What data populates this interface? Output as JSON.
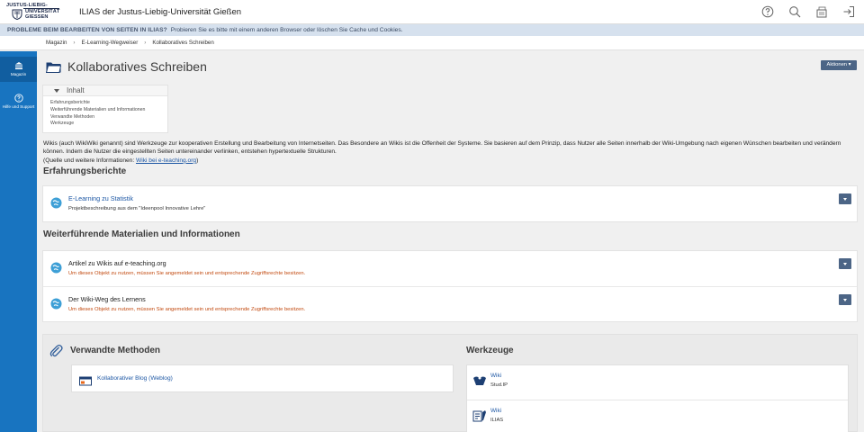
{
  "header": {
    "logo_text": [
      "JUSTUS-LIEBIG-",
      "UNIVERSITÄT",
      "GIESSEN"
    ],
    "site_title": "ILIAS der Justus-Liebig-Universität Gießen",
    "icons": [
      "help-icon",
      "search-icon",
      "notifications-icon",
      "logout-icon"
    ]
  },
  "banner": {
    "title": "PROBLEME BEIM BEARBEITEN VON SEITEN IN ILIAS?",
    "message": "Probieren Sie es bitte mit einem anderen Browser oder löschen Sie Cache und Cookies."
  },
  "breadcrumb": [
    "Magazin",
    "E-Learning-Wegweiser",
    "Kollaboratives Schreiben"
  ],
  "sidenav": [
    {
      "label": "Magazin",
      "icon": "repository-icon"
    },
    {
      "label": "Hilfe und Support",
      "icon": "help-support-icon"
    }
  ],
  "page": {
    "title": "Kollaboratives Schreiben",
    "actions_label": "Aktionen ▾"
  },
  "toc": {
    "heading": "Inhalt",
    "items": [
      "Erfahrungsberichte",
      "Weiterführende Materialien und Informationen",
      "Verwandte Methoden",
      "Werkzeuge"
    ]
  },
  "intro": {
    "text": "Wikis (auch WikiWiki genannt) sind Werkzeuge zur kooperativen Erstellung und Bearbeitung von Internetseiten. Das Besondere an Wikis ist die Offenheit der Systeme. Sie basieren auf dem Prinzip, dass Nutzer alle Seiten innerhalb der Wiki-Umgebung nach eigenen Wünschen bearbeiten und verändern können. Indem die Nutzer die eingestellten Seiten untereinander verlinken, entstehen hypertextuelle Strukturen.",
    "source_prefix": "(Quelle und weitere Informationen: ",
    "source_link": "Wiki bei e-teaching.org",
    "source_suffix": ")"
  },
  "sections": {
    "experience": {
      "title": "Erfahrungsberichte",
      "items": [
        {
          "title": "E-Learning zu Statistik",
          "desc": "Projektbeschreibung aus dem \"Ideenpool Innovative Lehre\""
        }
      ]
    },
    "materials": {
      "title": "Weiterführende Materialien und Informationen",
      "items": [
        {
          "title": "Artikel zu Wikis auf e-teaching.org",
          "desc": "Um dieses Objekt zu nutzen, müssen Sie angemeldet sein und entsprechende Zugriffsrechte besitzen."
        },
        {
          "title": "Der Wiki-Weg des Lernens",
          "desc": "Um dieses Objekt zu nutzen, müssen Sie angemeldet sein und entsprechende Zugriffsrechte besitzen."
        }
      ]
    },
    "related": {
      "title": "Verwandte Methoden",
      "items": [
        {
          "title": "Kollaborativer Blog (Weblog)"
        }
      ]
    },
    "tools": {
      "title": "Werkzeuge",
      "items": [
        {
          "name": "Wiki",
          "platform": "Stud.IP"
        },
        {
          "name": "Wiki",
          "platform": "ILIAS"
        }
      ]
    }
  },
  "colors": {
    "sidenav": "#1874c0",
    "banner": "#d6e1ee",
    "button": "#4c6586",
    "link": "#1d57a4",
    "warning": "#c24a10"
  }
}
